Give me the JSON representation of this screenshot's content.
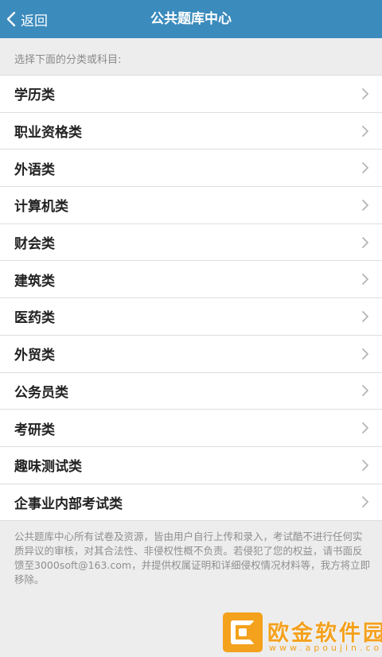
{
  "header": {
    "back_label": "返回",
    "title": "公共题库中心",
    "background": "#3b8bbd"
  },
  "hint": "选择下面的分类或科目:",
  "categories": [
    {
      "label": "学历类"
    },
    {
      "label": "职业资格类"
    },
    {
      "label": "外语类"
    },
    {
      "label": "计算机类"
    },
    {
      "label": "财会类"
    },
    {
      "label": "建筑类"
    },
    {
      "label": "医药类"
    },
    {
      "label": "外贸类"
    },
    {
      "label": "公务员类"
    },
    {
      "label": "考研类"
    },
    {
      "label": "趣味测试类"
    },
    {
      "label": "企事业内部考试类"
    }
  ],
  "notice": "公共题库中心所有试卷及资源，皆由用户自行上传和录入，考试酷不进行任何实质异议的审核，对其合法性、非侵权性概不负责。若侵犯了您的权益，请书面反馈至3000soft@163.com，并提供权属证明和详细侵权情况材料等，我方将立即移除。",
  "watermark": {
    "name": "欧金软件园",
    "url": "www.apoujin.com",
    "color": "#f4a11d"
  },
  "icons": {
    "back": "chevron-left-icon",
    "item": "chevron-right-icon"
  }
}
